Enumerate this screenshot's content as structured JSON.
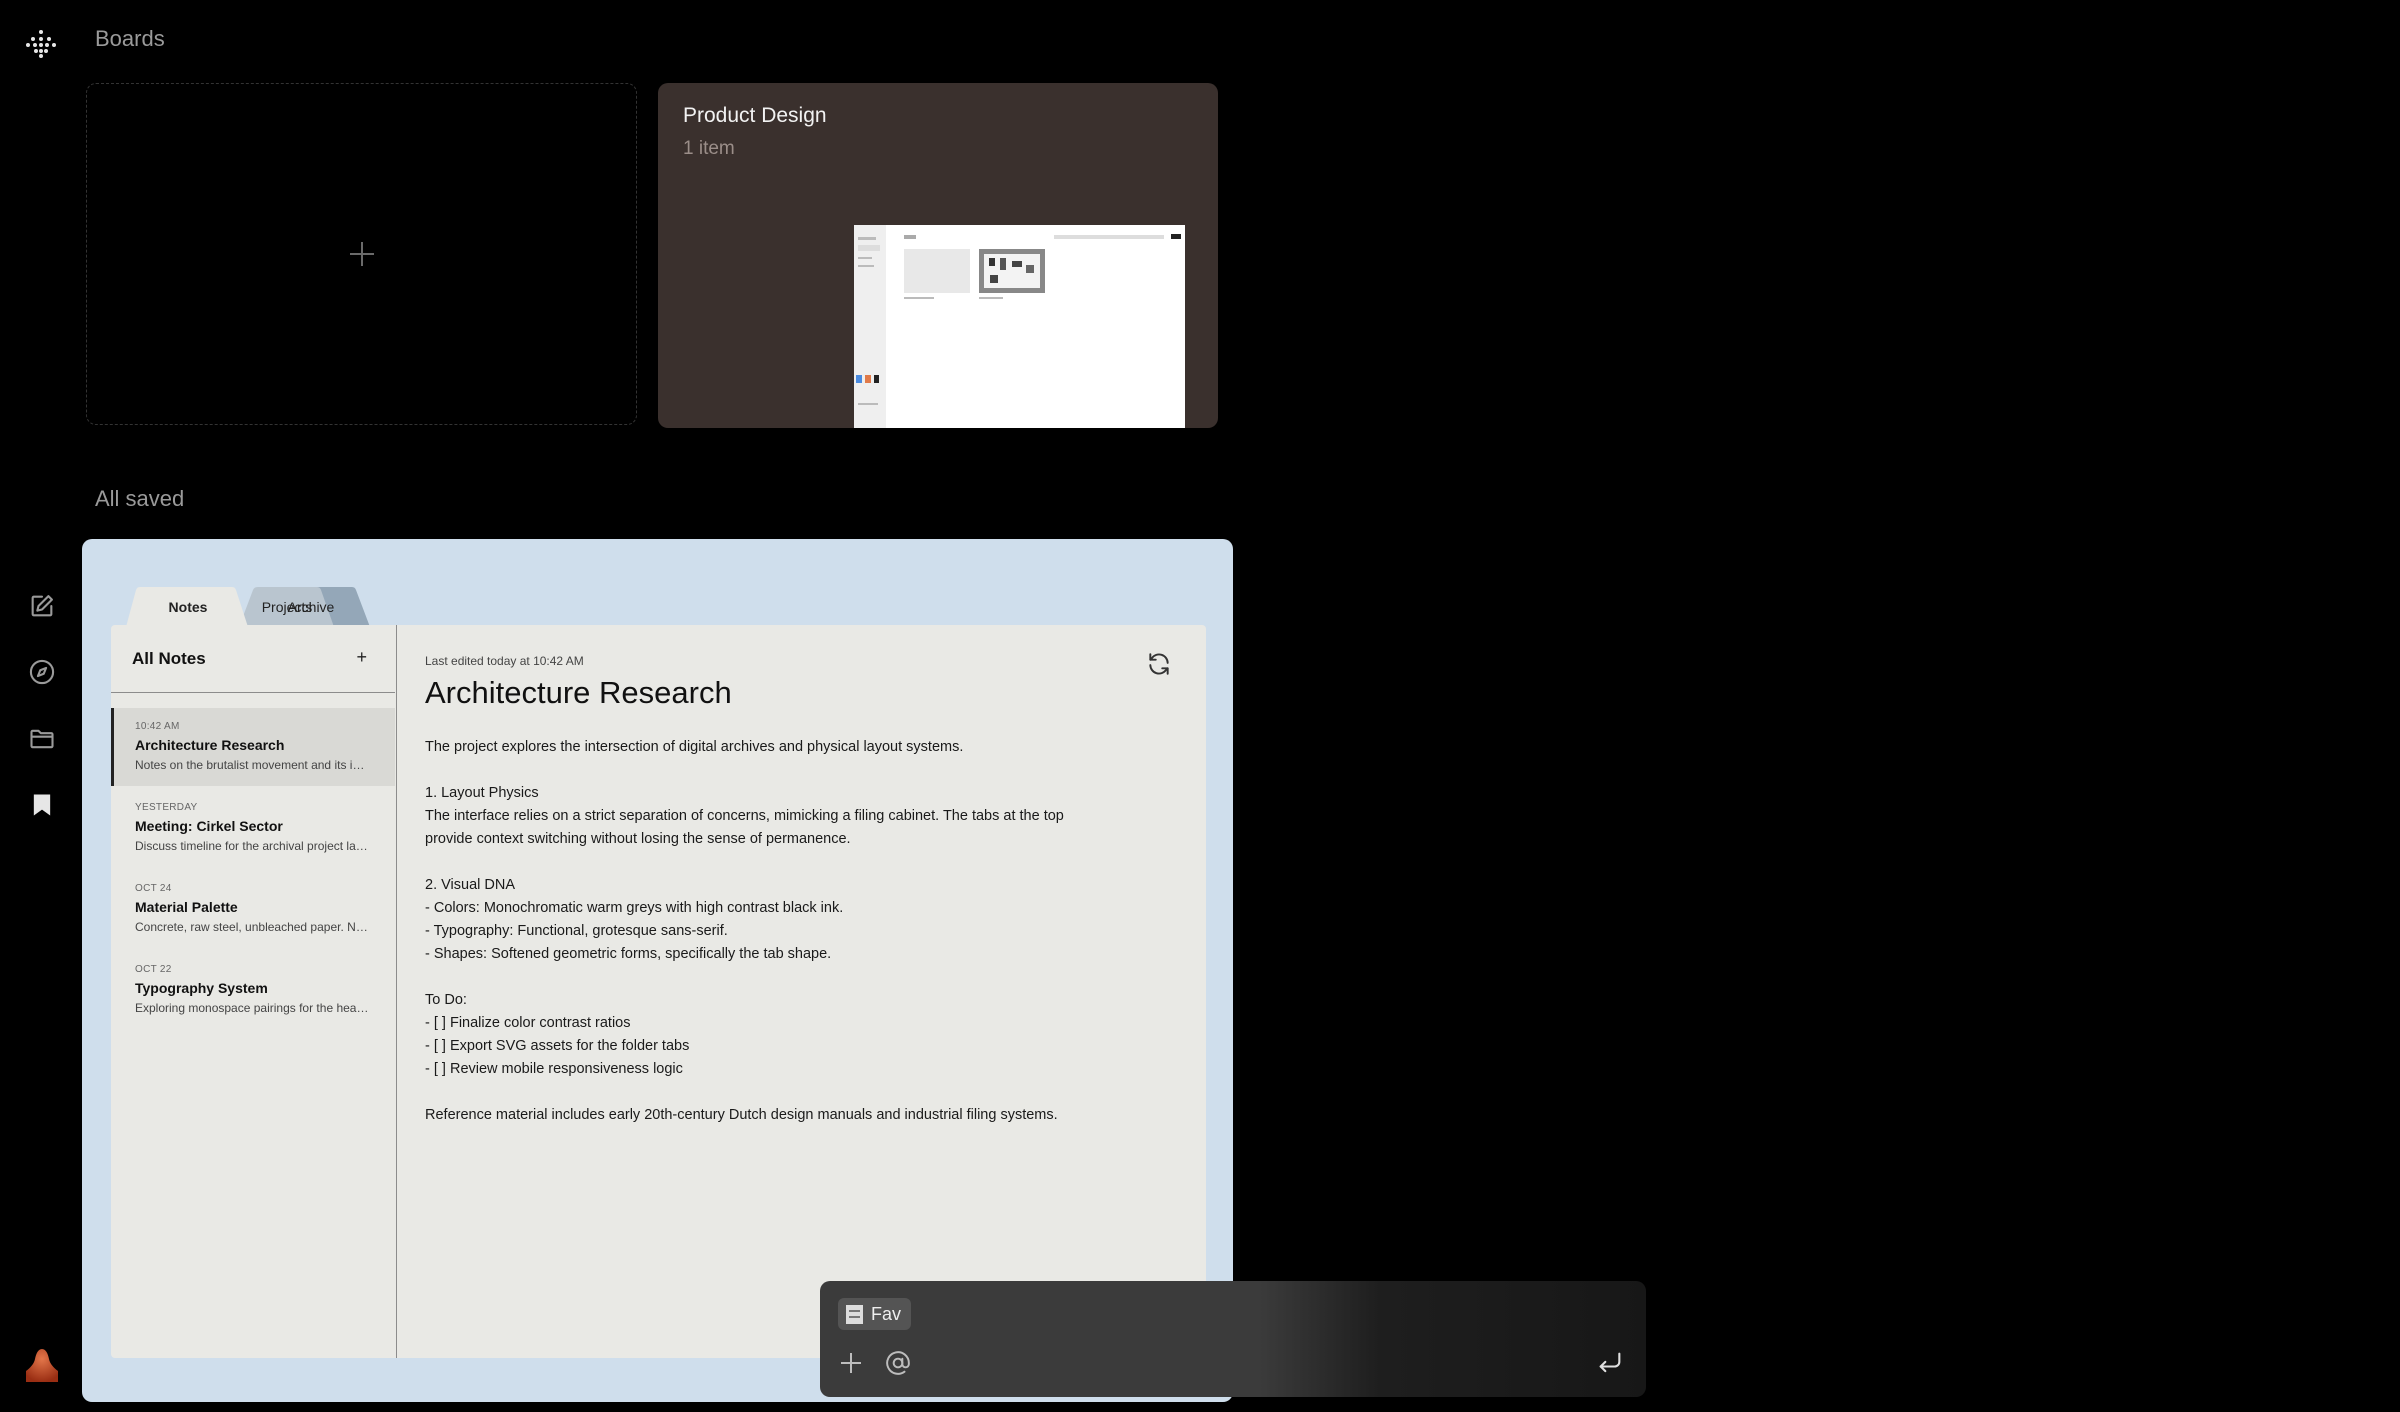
{
  "sections": {
    "boards_title": "Boards",
    "saved_title": "All saved"
  },
  "board": {
    "title": "Product Design",
    "count": "1 item"
  },
  "saved_preview": {
    "tabs": [
      "Notes",
      "Projects",
      "Archive"
    ],
    "list": {
      "title": "All Notes",
      "add": "+",
      "items": [
        {
          "date": "10:42 AM",
          "title": "Architecture Research",
          "preview": "Notes on the brutalist movement and its impact on modern UI"
        },
        {
          "date": "YESTERDAY",
          "title": "Meeting: Cirkel Sector",
          "preview": "Discuss timeline for the archival project launch"
        },
        {
          "date": "OCT 24",
          "title": "Material Palette",
          "preview": "Concrete, raw steel, unbleached paper. Needs more warmth"
        },
        {
          "date": "OCT 22",
          "title": "Typography System",
          "preview": "Exploring monospace pairings for the headings"
        }
      ]
    },
    "editor": {
      "meta": "Last edited today at 10:42 AM",
      "title": "Architecture Research",
      "lines": [
        "The project explores the intersection of digital archives and physical layout systems.",
        "",
        "1. Layout Physics",
        "The interface relies on a strict separation of concerns, mimicking a filing cabinet. The tabs at the top",
        "provide context switching without losing the sense of permanence.",
        "",
        "2. Visual DNA",
        "- Colors: Monochromatic warm greys with high contrast black ink.",
        "- Typography: Functional, grotesque sans-serif.",
        "- Shapes: Softened geometric forms, specifically the tab shape.",
        "",
        "To Do:",
        "- [ ] Finalize color contrast ratios",
        "- [ ] Export SVG assets for the folder tabs",
        "- [ ] Review mobile responsiveness logic",
        "",
        "Reference material includes early 20th-century Dutch design manuals and industrial filing systems."
      ]
    }
  },
  "composer": {
    "chip_label": "Fav"
  },
  "icons": {
    "logo": "dots-logo-icon",
    "rail": [
      "edit-icon",
      "compass-icon",
      "folder-icon",
      "bookmark-icon"
    ],
    "composer": [
      "plus-icon",
      "at-icon",
      "enter-icon"
    ],
    "editor": "refresh-icon"
  },
  "colors": {
    "background": "#000000",
    "board_card": "#3a302d",
    "saved_card": "#cfdeec",
    "panel": "#e9e9e5"
  }
}
